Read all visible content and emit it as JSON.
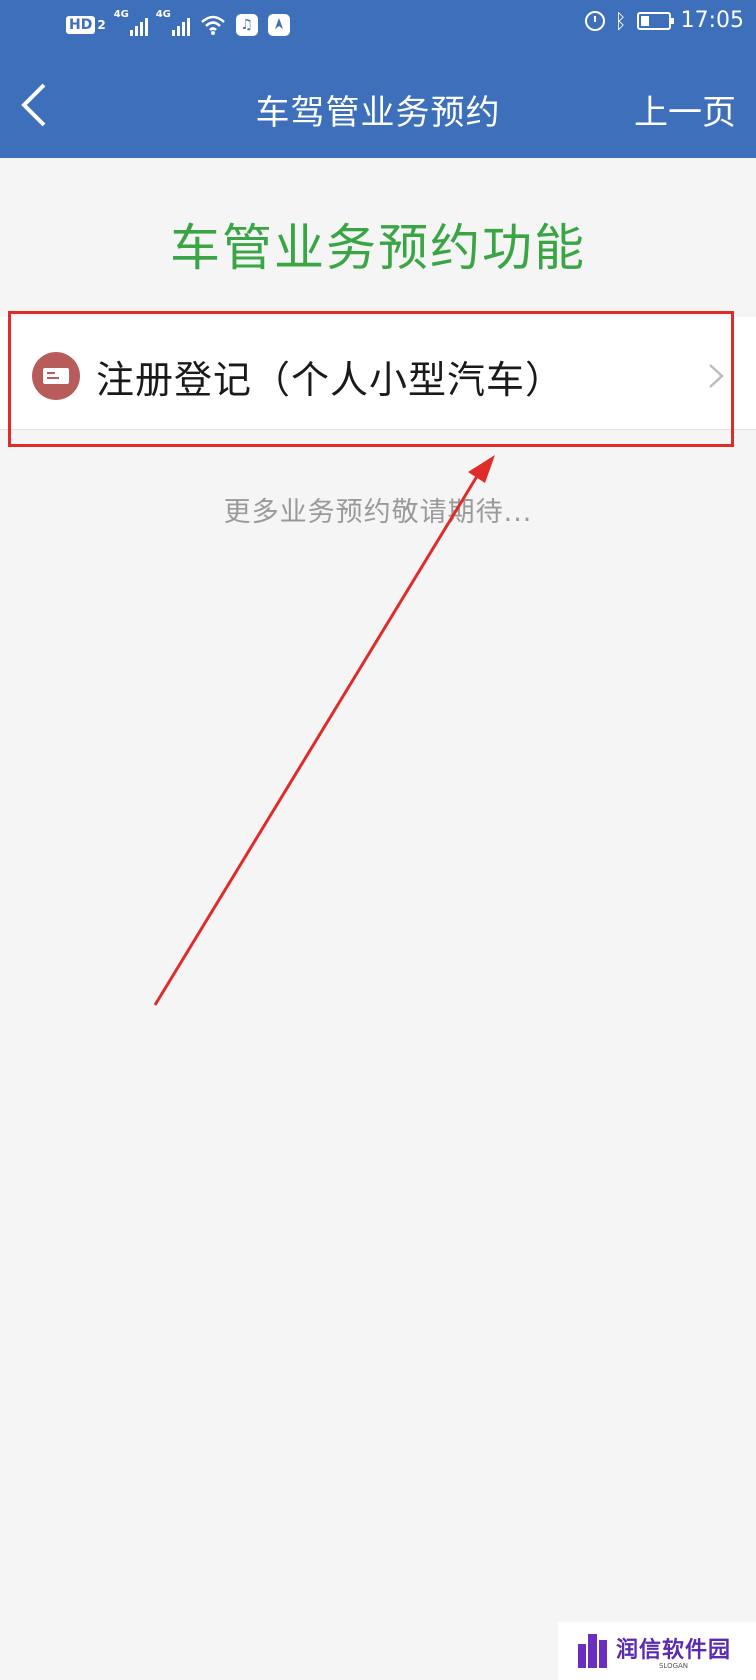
{
  "status_bar": {
    "hd_label": "HD",
    "hd_sub": "2",
    "signal_labels": [
      "4G",
      "4G"
    ],
    "music_glyph": "♫",
    "time": "17:05",
    "icons": [
      "signal-icon",
      "wifi-icon",
      "music-app-icon",
      "compass-app-icon",
      "alarm-icon",
      "bluetooth-icon",
      "battery-icon"
    ]
  },
  "nav": {
    "title": "车驾管业务预约",
    "prev_label": "上一页"
  },
  "main": {
    "heading": "车管业务预约功能",
    "items": [
      {
        "label": "注册登记（个人小型汽车）"
      }
    ],
    "more_hint": "更多业务预约敬请期待..."
  },
  "watermark": {
    "title": "润信软件园",
    "sub": "SLOGAN"
  },
  "colors": {
    "nav_bg": "#3e6fba",
    "heading": "#3aa544",
    "item_icon_bg": "#b85b5b",
    "annotation": "#e02b2b",
    "watermark": "#5a2bb0"
  }
}
